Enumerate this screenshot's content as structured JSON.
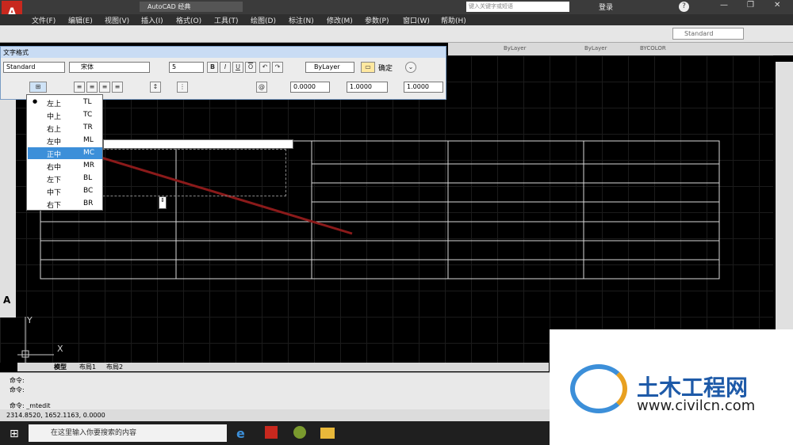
{
  "title": {
    "search_placeholder": "键入关键字或短语",
    "login": "登录",
    "workspace": "AutoCAD 经典"
  },
  "menu": [
    "文件(F)",
    "编辑(E)",
    "视图(V)",
    "插入(I)",
    "格式(O)",
    "工具(T)",
    "绘图(D)",
    "标注(N)",
    "修改(M)",
    "参数(P)",
    "窗口(W)",
    "帮助(H)"
  ],
  "toolbar": {
    "style_value": "Standard",
    "layer_values": [
      "ByLayer",
      "ByLayer",
      "BYCOLOR"
    ]
  },
  "text_format": {
    "title": "文字格式",
    "style": "Standard",
    "font": "宋体",
    "height": "5",
    "bold": "B",
    "italic": "I",
    "underline": "U",
    "overline": "O",
    "color": "ByLayer",
    "ok": "确定",
    "oblique": "0.0000",
    "tracking": "1.0000",
    "width": "1.0000"
  },
  "justify_menu": [
    {
      "zh": "左上",
      "code": "TL",
      "selected": true
    },
    {
      "zh": "中上",
      "code": "TC"
    },
    {
      "zh": "右上",
      "code": "TR"
    },
    {
      "zh": "左中",
      "code": "ML"
    },
    {
      "zh": "正中",
      "code": "MC",
      "highlighted": true
    },
    {
      "zh": "右中",
      "code": "MR"
    },
    {
      "zh": "左下",
      "code": "BL"
    },
    {
      "zh": "中下",
      "code": "BC"
    },
    {
      "zh": "右下",
      "code": "BR"
    }
  ],
  "tabs": [
    "模型",
    "布局1",
    "布局2"
  ],
  "command": {
    "lines": [
      "命令:",
      "命令:"
    ],
    "current": "命令: _mtedit"
  },
  "status": {
    "coords": "2314.8520, 1652.1163, 0.0000"
  },
  "taskbar": {
    "search": "在这里输入你要搜索的内容"
  },
  "logo": {
    "title": "土木工程网",
    "url": "www.civilcn.com"
  },
  "axes": {
    "y": "Y",
    "x": "X"
  },
  "colors": {
    "accent": "#3c8fd9",
    "arrow": "#8b1a1a",
    "grid": "#1b1b1b"
  }
}
